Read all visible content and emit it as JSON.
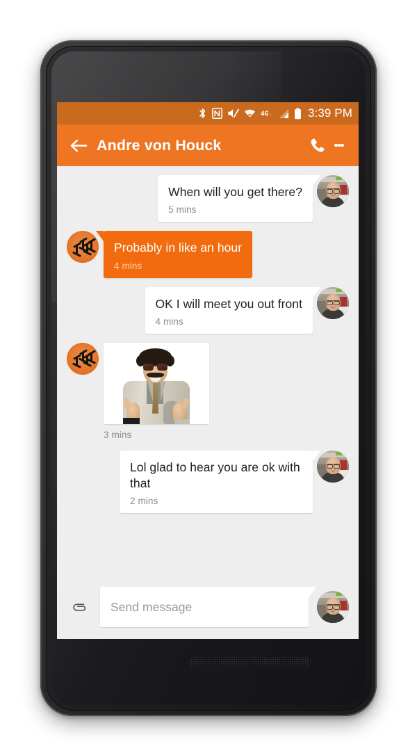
{
  "device": {
    "name": "android-smartphone",
    "front_camera": "front-camera",
    "earpiece": "earpiece-speaker",
    "bottom_speaker": "bottom-speaker"
  },
  "status_bar": {
    "time": "3:39 PM",
    "background": "#c96a1e",
    "icons": [
      {
        "name": "bluetooth-icon",
        "label": "Bluetooth"
      },
      {
        "name": "nfc-icon",
        "label": "NFC"
      },
      {
        "name": "volume-mute-icon",
        "label": "Sound off"
      },
      {
        "name": "wifi-icon",
        "label": "Wi-Fi"
      },
      {
        "name": "network-4g-icon",
        "label": "4G"
      },
      {
        "name": "signal-bars-icon",
        "label": "Cellular signal"
      },
      {
        "name": "battery-icon",
        "label": "Battery"
      }
    ]
  },
  "app_bar": {
    "title": "Andre von Houck",
    "background": "#ee7623",
    "back_label": "Back",
    "call_label": "Call",
    "overflow_label": "More options"
  },
  "theme": {
    "accent": "#ee7623",
    "sent_bubble": "#f26b0f",
    "received_bubble": "#ffffff",
    "chat_background": "#efeeee",
    "text_primary": "#202020",
    "text_timestamp": "#8a8a8a",
    "sent_timestamp": "#fbd0ae"
  },
  "thread": {
    "messages": [
      {
        "id": "msg-1",
        "direction": "received",
        "type": "text",
        "text": "When will you get there?",
        "time": "5 mins",
        "avatar": "contact-avatar"
      },
      {
        "id": "msg-2",
        "direction": "sent",
        "type": "text",
        "text": "Probably in like an hour",
        "time": "4 mins",
        "avatar": "user-avatar"
      },
      {
        "id": "msg-3",
        "direction": "received",
        "type": "text",
        "text": "OK I will meet you out front",
        "time": "4 mins",
        "avatar": "contact-avatar"
      },
      {
        "id": "msg-4",
        "direction": "sent",
        "type": "image",
        "image_alt": "Man in grey suit with sunglasses giving two thumbs up",
        "time": "3 mins",
        "avatar": "user-avatar"
      },
      {
        "id": "msg-5",
        "direction": "received",
        "type": "text",
        "text": "Lol glad to hear you are ok with that",
        "time": "2 mins",
        "avatar": "contact-avatar"
      }
    ]
  },
  "composer": {
    "attach_label": "Attach file",
    "placeholder": "Send message",
    "value": "",
    "avatar": "contact-avatar"
  }
}
